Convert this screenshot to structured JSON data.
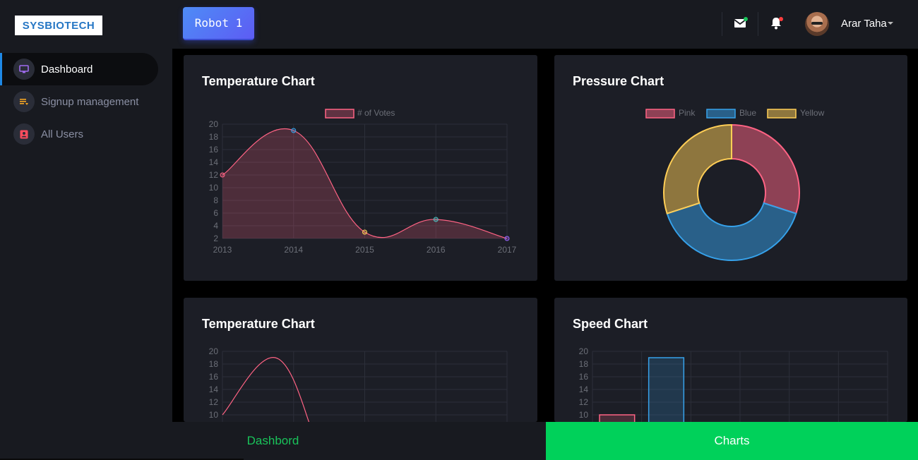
{
  "header": {
    "logo_text": "SYSBIOTECH",
    "robot_button": "Robot 1",
    "user": {
      "name": "Arar Taha"
    },
    "colors": {
      "mail_dot": "#19c35a",
      "bell_dot": "#ff3d3d"
    }
  },
  "sidebar": {
    "items": [
      {
        "label": "Dashboard",
        "icon": "monitor-icon",
        "active": true
      },
      {
        "label": "Signup management",
        "icon": "playlist-icon",
        "active": false
      },
      {
        "label": "All Users",
        "icon": "contact-icon",
        "active": false
      }
    ]
  },
  "cards": {
    "temp1_title": "Temperature Chart",
    "pressure_title": "Pressure Chart",
    "temp2_title": "Temperature Chart",
    "speed_title": "Speed Chart"
  },
  "chart_data": [
    {
      "type": "area",
      "title": "Temperature Chart",
      "x": [
        "2013",
        "2014",
        "2015",
        "2016",
        "2017"
      ],
      "series": [
        {
          "name": "# of Votes",
          "values": [
            12,
            19,
            3,
            5,
            2
          ]
        }
      ],
      "ylim": [
        2,
        20
      ],
      "yticks": [
        2,
        4,
        6,
        8,
        10,
        12,
        14,
        16,
        18,
        20
      ],
      "grid": true,
      "legend": "top",
      "point_colors": [
        "#ff6384",
        "#36a2eb",
        "#ffce56",
        "#4bc0c0",
        "#9966ff"
      ]
    },
    {
      "type": "pie",
      "title": "Pressure Chart",
      "labels": [
        "Pink",
        "Blue",
        "Yellow"
      ],
      "values": [
        30,
        40,
        30
      ],
      "colors": [
        "#ff6384",
        "#36a2eb",
        "#ffce56"
      ],
      "legend": "top"
    },
    {
      "type": "line",
      "title": "Temperature Chart",
      "series": [
        {
          "values": [
            10,
            19,
            10
          ]
        }
      ],
      "yticks": [
        10,
        12,
        14,
        16,
        18,
        20
      ],
      "ylim": [
        2,
        20
      ],
      "grid": true
    },
    {
      "type": "bar",
      "title": "Speed Chart",
      "values": [
        10,
        19
      ],
      "colors": [
        "#ff6384",
        "#36a2eb"
      ],
      "yticks": [
        10,
        12,
        14,
        16,
        18,
        20
      ],
      "ylim": [
        2,
        20
      ],
      "grid": true
    }
  ],
  "bottom_tabs": {
    "dashboard": "Dashbord",
    "charts": "Charts"
  }
}
